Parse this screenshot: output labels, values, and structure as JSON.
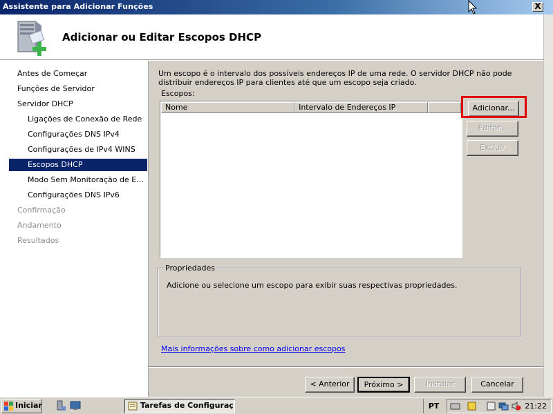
{
  "window": {
    "title": "Assistente para Adicionar Funções",
    "close_label": "X",
    "header_title": "Adicionar ou Editar Escopos DHCP"
  },
  "sidebar": {
    "items": [
      {
        "label": "Antes de Começar",
        "state": "normal"
      },
      {
        "label": "Funções de Servidor",
        "state": "normal"
      },
      {
        "label": "Servidor DHCP",
        "state": "normal"
      },
      {
        "label": "Ligações de Conexão de Rede",
        "state": "sub"
      },
      {
        "label": "Configurações DNS IPv4",
        "state": "sub"
      },
      {
        "label": "Configurações de IPv4 WINS",
        "state": "sub"
      },
      {
        "label": "Escopos DHCP",
        "state": "selected"
      },
      {
        "label": "Modo Sem Monitoração de Est...",
        "state": "sub"
      },
      {
        "label": "Configurações DNS IPv6",
        "state": "sub"
      },
      {
        "label": "Confirmação",
        "state": "disabled"
      },
      {
        "label": "Andamento",
        "state": "disabled"
      },
      {
        "label": "Resultados",
        "state": "disabled"
      }
    ]
  },
  "main": {
    "description": "Um escopo é o intervalo dos possíveis endereços IP de uma rede. O servidor DHCP não pode distribuir endereços IP para clientes até que um escopo seja criado.",
    "scopes_label": "Escopos:",
    "columns": [
      "Nome",
      "Intervalo de Endereços IP",
      ""
    ],
    "rows": [],
    "buttons": {
      "add": "Adicionar...",
      "edit": "Editar...",
      "delete": "Excluir"
    },
    "properties_legend": "Propriedades",
    "properties_text": "Adicione ou selecione um escopo para exibir suas respectivas propriedades.",
    "more_info_link": "Mais informações sobre como adicionar escopos"
  },
  "footer": {
    "back": "< Anterior",
    "next": "Próximo >",
    "install": "Instalar",
    "cancel": "Cancelar"
  },
  "taskbar": {
    "start_label": "Iniciar",
    "task_label": "Tarefas de Configuraç...",
    "language": "PT",
    "clock": "21:22"
  },
  "colors": {
    "selection": "#0a246a",
    "highlight_box": "#e00000",
    "link": "#0000ee",
    "face": "#d4d0c8"
  }
}
